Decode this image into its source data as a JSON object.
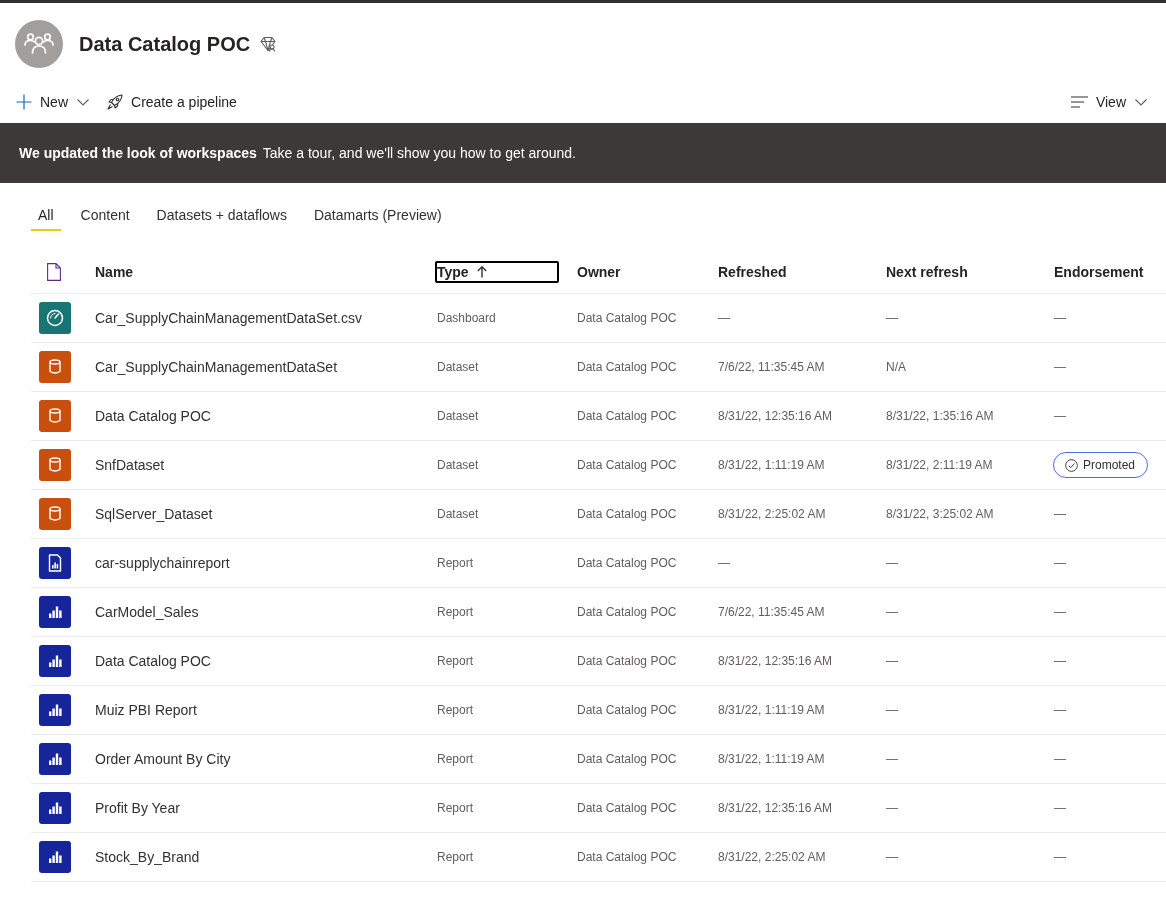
{
  "workspace": {
    "title": "Data Catalog POC"
  },
  "toolbar": {
    "new_label": "New",
    "pipeline_label": "Create a pipeline",
    "view_label": "View"
  },
  "banner": {
    "title": "We updated the look of workspaces",
    "message": "Take a tour, and we'll show you how to get around."
  },
  "tabs": [
    {
      "label": "All",
      "selected": true
    },
    {
      "label": "Content",
      "selected": false
    },
    {
      "label": "Datasets + dataflows",
      "selected": false
    },
    {
      "label": "Datamarts (Preview)",
      "selected": false
    }
  ],
  "table": {
    "columns": [
      {
        "label": "Name",
        "sorted": false,
        "focused": false
      },
      {
        "label": "Type",
        "sorted": true,
        "focused": true
      },
      {
        "label": "Owner",
        "sorted": false,
        "focused": false
      },
      {
        "label": "Refreshed",
        "sorted": false,
        "focused": false
      },
      {
        "label": "Next refresh",
        "sorted": false,
        "focused": false
      },
      {
        "label": "Endorsement",
        "sorted": false,
        "focused": false
      }
    ],
    "rows": [
      {
        "kind": "dashboard",
        "name": "Car_SupplyChainManagementDataSet.csv",
        "type": "Dashboard",
        "owner": "Data Catalog POC",
        "refreshed": "—",
        "next_refresh": "—",
        "endorsement": "—",
        "promoted": false
      },
      {
        "kind": "dataset",
        "name": "Car_SupplyChainManagementDataSet",
        "type": "Dataset",
        "owner": "Data Catalog POC",
        "refreshed": "7/6/22, 11:35:45 AM",
        "next_refresh": "N/A",
        "endorsement": "—",
        "promoted": false
      },
      {
        "kind": "dataset",
        "name": "Data Catalog POC",
        "type": "Dataset",
        "owner": "Data Catalog POC",
        "refreshed": "8/31/22, 12:35:16 AM",
        "next_refresh": "8/31/22, 1:35:16 AM",
        "endorsement": "—",
        "promoted": false
      },
      {
        "kind": "dataset",
        "name": "SnfDataset",
        "type": "Dataset",
        "owner": "Data Catalog POC",
        "refreshed": "8/31/22, 1:11:19 AM",
        "next_refresh": "8/31/22, 2:11:19 AM",
        "endorsement": "Promoted",
        "promoted": true
      },
      {
        "kind": "dataset",
        "name": "SqlServer_Dataset",
        "type": "Dataset",
        "owner": "Data Catalog POC",
        "refreshed": "8/31/22, 2:25:02 AM",
        "next_refresh": "8/31/22, 3:25:02 AM",
        "endorsement": "—",
        "promoted": false
      },
      {
        "kind": "paginated",
        "name": "car-supplychainreport",
        "type": "Report",
        "owner": "Data Catalog POC",
        "refreshed": "—",
        "next_refresh": "—",
        "endorsement": "—",
        "promoted": false
      },
      {
        "kind": "report",
        "name": "CarModel_Sales",
        "type": "Report",
        "owner": "Data Catalog POC",
        "refreshed": "7/6/22, 11:35:45 AM",
        "next_refresh": "—",
        "endorsement": "—",
        "promoted": false
      },
      {
        "kind": "report",
        "name": "Data Catalog POC",
        "type": "Report",
        "owner": "Data Catalog POC",
        "refreshed": "8/31/22, 12:35:16 AM",
        "next_refresh": "—",
        "endorsement": "—",
        "promoted": false
      },
      {
        "kind": "report",
        "name": "Muiz PBI Report",
        "type": "Report",
        "owner": "Data Catalog POC",
        "refreshed": "8/31/22, 1:11:19 AM",
        "next_refresh": "—",
        "endorsement": "—",
        "promoted": false
      },
      {
        "kind": "report",
        "name": "Order Amount By City",
        "type": "Report",
        "owner": "Data Catalog POC",
        "refreshed": "8/31/22, 1:11:19 AM",
        "next_refresh": "—",
        "endorsement": "—",
        "promoted": false
      },
      {
        "kind": "report",
        "name": "Profit By Year",
        "type": "Report",
        "owner": "Data Catalog POC",
        "refreshed": "8/31/22, 12:35:16 AM",
        "next_refresh": "—",
        "endorsement": "—",
        "promoted": false
      },
      {
        "kind": "report",
        "name": "Stock_By_Brand",
        "type": "Report",
        "owner": "Data Catalog POC",
        "refreshed": "8/31/22, 2:25:02 AM",
        "next_refresh": "—",
        "endorsement": "—",
        "promoted": false
      }
    ]
  }
}
